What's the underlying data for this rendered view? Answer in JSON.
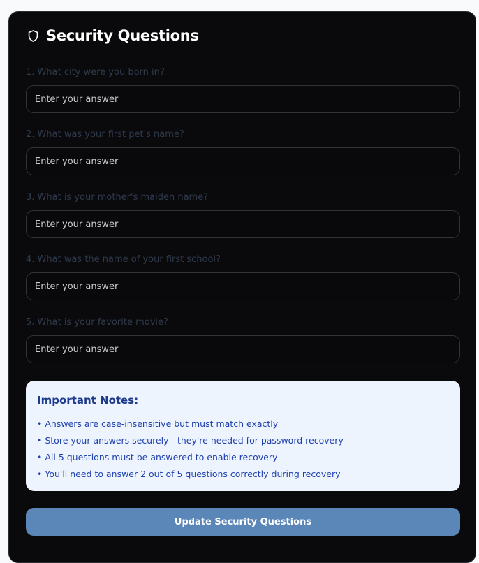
{
  "header": {
    "title": "Security Questions",
    "icon": "shield-icon"
  },
  "questions": [
    {
      "label": "1. What city were you born in?",
      "placeholder": "Enter your answer",
      "value": ""
    },
    {
      "label": "2. What was your first pet's name?",
      "placeholder": "Enter your answer",
      "value": ""
    },
    {
      "label": "3. What is your mother's maiden name?",
      "placeholder": "Enter your answer",
      "value": ""
    },
    {
      "label": "4. What was the name of your first school?",
      "placeholder": "Enter your answer",
      "value": ""
    },
    {
      "label": "5. What is your favorite movie?",
      "placeholder": "Enter your answer",
      "value": ""
    }
  ],
  "notes": {
    "title": "Important Notes:",
    "items": [
      "• Answers are case-insensitive but must match exactly",
      "• Store your answers securely - they're needed for password recovery",
      "• All 5 questions must be answered to enable recovery",
      "• You'll need to answer 2 out of 5 questions correctly during recovery"
    ]
  },
  "submit": {
    "label": "Update Security Questions"
  },
  "colors": {
    "card_background": "#0a0a0c",
    "notes_background": "#eef4fd",
    "notes_text": "#1e40af",
    "button_background": "#5b86b8"
  }
}
